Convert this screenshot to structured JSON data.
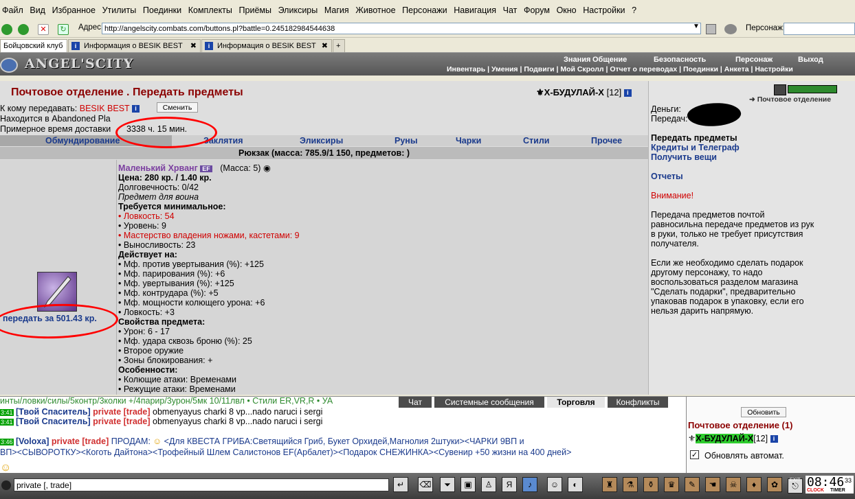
{
  "menubar": [
    "Файл",
    "Вид",
    "Избранное",
    "Утилиты",
    "Поединки",
    "Комплекты",
    "Приёмы",
    "Эликсиры",
    "Магия",
    "Животное",
    "Персонажи",
    "Навигация",
    "Чат",
    "Форум",
    "Окно",
    "Настройки",
    "?"
  ],
  "address": {
    "label": "Адрес:",
    "url": "http://angelscity.combats.com/buttons.pl?battle=0.245182984544638",
    "persona_label": "Персонаж:"
  },
  "tabs": [
    "Бойцовский клуб",
    "Информация о BESIK BEST",
    "Информация о BESIK BEST"
  ],
  "game": {
    "logo": "ANGEL'SCITY",
    "top_links": [
      "Знания",
      "Общение",
      "Безопасность",
      "Персонаж",
      "Выход"
    ],
    "subnav": "Инвентарь | Умения | Подвиги | Мой Скролл | Отчет о переводах | Поединки | Анкета | Настройки"
  },
  "page": {
    "title": "Почтовое отделение .  Передать предметы",
    "player": "Х-БУДУЛАЙ-Х",
    "player_level": "[12]",
    "recipient_label": "К кому передавать:",
    "recipient_name": "BESIK BEST",
    "change_button": "Сменить",
    "location_label": "Находится в Abandoned Pla",
    "delivery_label": "Примерное время доставки",
    "delivery_time": "3338 ч. 15 мин.",
    "categories": [
      "Обмундирование",
      "Заклятия",
      "Эликсиры",
      "Руны",
      "Чарки",
      "Стили",
      "Прочее"
    ],
    "backpack": "Рюкзак (масса: 785.9/1 150, предметов: )",
    "transfer_link": "передать за 501.43 кр."
  },
  "item": {
    "name": "Маленький Хрванг",
    "badge": "EF",
    "mass": "(Масса: 5)",
    "lines": [
      {
        "t": "Цена: 280 кр. / 1.40 кр.",
        "s": "bold"
      },
      {
        "t": "Долговечность: 0/42",
        "s": ""
      },
      {
        "t": "Предмет для воина",
        "s": "italic"
      },
      {
        "t": "Требуется минимальное:",
        "s": "bold"
      },
      {
        "t": "• Ловкость: 54",
        "s": "red"
      },
      {
        "t": "• Уровень: 9",
        "s": ""
      },
      {
        "t": "• Мастерство владения ножами, кастетами: 9",
        "s": "red"
      },
      {
        "t": "• Выносливость: 23",
        "s": ""
      },
      {
        "t": "Действует на:",
        "s": "bold"
      },
      {
        "t": "• Мф. против увертывания (%): +125",
        "s": ""
      },
      {
        "t": "• Мф. парирования (%): +6",
        "s": ""
      },
      {
        "t": "• Мф. увертывания (%): +125",
        "s": ""
      },
      {
        "t": "• Мф. контрудара (%): +5",
        "s": ""
      },
      {
        "t": "• Мф. мощности колющего урона: +6",
        "s": ""
      },
      {
        "t": "• Ловкость: +3",
        "s": ""
      },
      {
        "t": "Свойства предмета:",
        "s": "bold"
      },
      {
        "t": "• Урон: 6 - 17",
        "s": ""
      },
      {
        "t": "• Мф. удара сквозь броню (%): 25",
        "s": ""
      },
      {
        "t": "• Второе оружие",
        "s": ""
      },
      {
        "t": "• Зоны блокирования: +",
        "s": ""
      },
      {
        "t": "Особенности:",
        "s": "bold"
      },
      {
        "t": "• Колющие атаки: Временами",
        "s": ""
      },
      {
        "t": "• Режущие атаки: Временами",
        "s": ""
      }
    ]
  },
  "right": {
    "breadcrumb": "Почтовое отделение",
    "money_label": "Деньги:",
    "transfer_label": "Передач:",
    "links": [
      "Передать предметы",
      "Кредиты и Телеграф",
      "Получить вещи"
    ],
    "reports": "Отчеты",
    "warning": "Внимание!",
    "para1": [
      "Передача предметов почтой",
      "равносильна передаче предметов из рук",
      "в руки, только не требует присутствия",
      "получателя."
    ],
    "para2": [
      "Если же необходимо сделать подарок",
      "другому персонажу, то надо",
      "воспользоваться разделом магазина",
      "\"Сделать подарки\", предварительно",
      "упаковав подарок в упаковку, если его",
      "нельзя дарить напрямую."
    ]
  },
  "chat": {
    "top_line": "инты/ловки/силы/5контр/3колки +/4парир/3урон/5мк 10/11лвл • Стили ER,VR,R • УА",
    "tabs": [
      "Чат",
      "Системные сообщения",
      "Торговля",
      "Конфликты"
    ],
    "msg_time1": "3:41",
    "msg_time2": "3:41",
    "msg_time3": "3:46",
    "sender1": "[Твой Спаситель]",
    "private_tag": "private [trade]",
    "msg1": "obmenyayus charki 8 vp...nado naruci i sergi",
    "sender3": "[Voloxa]",
    "msg3a": "ПРОДАМ:",
    "msg3b": "<Для КВЕСТА ГРИБА:Светящийся Гриб, Букет Орхидей,Магнолия 2штуки><ЧАРКИ 9ВП и",
    "msg3c": "ВП><СЫВОРОТКУ><Коготь Дайтона><Трофейный Шлем Салистонов EF(Арбалет)><Подарок СНЕЖИНКА><Сувенир +50 жизни на 400 дней>",
    "refresh_button": "Обновить",
    "room_title": "Почтовое отделение (1)",
    "room_player": "Х-БУДУЛАЙ-Х",
    "room_level": "[12]",
    "auto_label": "Обновлять автомат."
  },
  "bottom": {
    "input_value": "private [, trade]",
    "clock": "08:46",
    "clock_sec": "33",
    "clock_label": "CLOCK",
    "timer_label": "TIMER",
    "exit": "EXIT"
  },
  "colors": {
    "accent_maroon": "#8b0000",
    "link_blue": "#1a3a8c",
    "annotation_red": "#ff0000",
    "chat_green": "#00a000"
  }
}
